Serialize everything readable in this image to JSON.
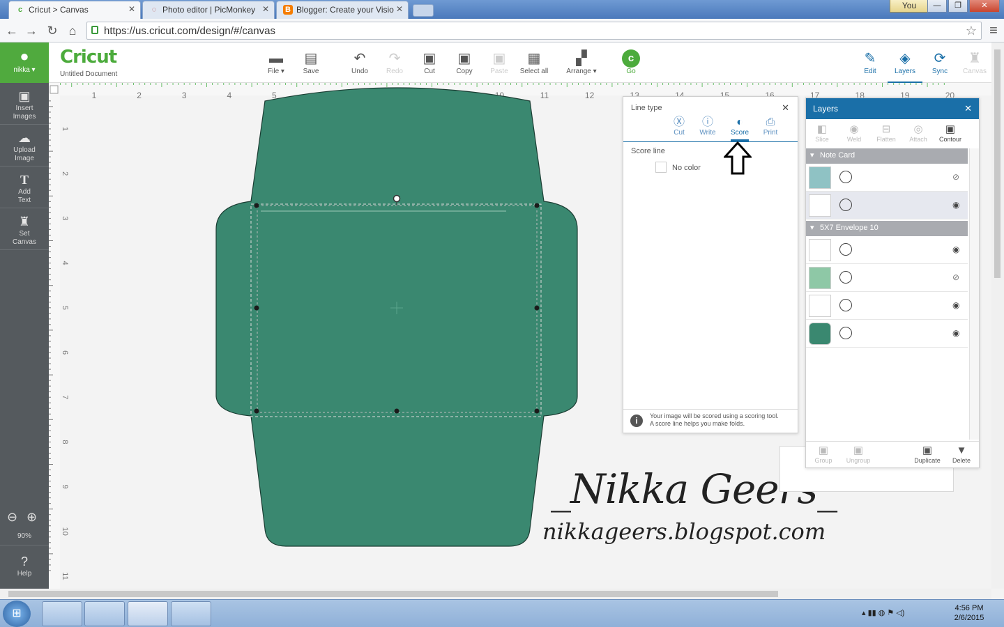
{
  "browser": {
    "tabs": [
      {
        "label": "Cricut > Canvas",
        "active": true
      },
      {
        "label": "Photo editor | PicMonkey",
        "active": false
      },
      {
        "label": "Blogger: Create your Visio",
        "active": false
      }
    ],
    "user_button": "You",
    "url": "https://us.cricut.com/design/#/canvas"
  },
  "header": {
    "logo": "Cricut",
    "document_name": "Untitled Document",
    "user": "nikka",
    "tools": [
      {
        "label": "File",
        "icon": "folder-icon",
        "dropdown": true,
        "enabled": true
      },
      {
        "label": "Save",
        "icon": "save-icon",
        "enabled": true
      },
      {
        "label": "Undo",
        "icon": "undo-icon",
        "enabled": true
      },
      {
        "label": "Redo",
        "icon": "redo-icon",
        "enabled": false
      },
      {
        "label": "Cut",
        "icon": "cut-icon",
        "enabled": true
      },
      {
        "label": "Copy",
        "icon": "copy-icon",
        "enabled": true
      },
      {
        "label": "Paste",
        "icon": "paste-icon",
        "enabled": false
      },
      {
        "label": "Select all",
        "icon": "select-all-icon",
        "enabled": true
      },
      {
        "label": "Arrange",
        "icon": "arrange-icon",
        "dropdown": true,
        "enabled": true
      },
      {
        "label": "Go",
        "icon": "go-icon",
        "enabled": true
      }
    ],
    "right_tools": [
      {
        "label": "Edit",
        "icon": "edit-icon",
        "enabled": true
      },
      {
        "label": "Layers",
        "icon": "layers-icon",
        "enabled": true,
        "active": true
      },
      {
        "label": "Sync",
        "icon": "sync-icon",
        "enabled": true
      },
      {
        "label": "Canvas",
        "icon": "canvas-icon",
        "enabled": false
      }
    ]
  },
  "sidebar": {
    "items": [
      {
        "label1": "Insert",
        "label2": "Images",
        "icon": "image-icon"
      },
      {
        "label1": "Upload",
        "label2": "Image",
        "icon": "upload-icon"
      },
      {
        "label1": "Add",
        "label2": "Text",
        "icon": "text-icon"
      },
      {
        "label1": "Set",
        "label2": "Canvas",
        "icon": "shirt-icon"
      }
    ],
    "zoom": "90%",
    "help": "Help"
  },
  "rulers": {
    "horizontal": [
      "1",
      "2",
      "3",
      "4",
      "5",
      "6",
      "7",
      "8",
      "9",
      "10",
      "11",
      "12",
      "13",
      "14",
      "15",
      "16",
      "17",
      "18",
      "19",
      "20"
    ],
    "vertical": [
      "1",
      "2",
      "3",
      "4",
      "5",
      "6",
      "7",
      "8",
      "9",
      "10",
      "11"
    ]
  },
  "line_type_panel": {
    "title": "Line type",
    "options": [
      {
        "label": "Cut",
        "active": false
      },
      {
        "label": "Write",
        "active": false
      },
      {
        "label": "Score",
        "active": true
      },
      {
        "label": "Print",
        "active": false
      }
    ],
    "section_label": "Score line",
    "color_label": "No color",
    "info_line1": "Your image will be scored using a scoring tool.",
    "info_line2": "A score line helps you make folds."
  },
  "layers_panel": {
    "title": "Layers",
    "top_tools": [
      "Slice",
      "Weld",
      "Flatten",
      "Attach",
      "Contour"
    ],
    "groups": [
      {
        "name": "Note Card",
        "rows": [
          {
            "thumb": "#8fc2c4",
            "op": "cut",
            "visible": false,
            "selected": false
          },
          {
            "thumb": "#ffffff",
            "op": "score",
            "visible": true,
            "selected": true
          }
        ]
      },
      {
        "name": "5X7 Envelope 10",
        "rows": [
          {
            "thumb": "#ffffff",
            "op": "score",
            "visible": true,
            "selected": false
          },
          {
            "thumb": "#8ec8a6",
            "op": "cut",
            "visible": false,
            "selected": false
          },
          {
            "thumb": "#ffffff",
            "op": "score",
            "visible": true,
            "selected": false
          },
          {
            "thumb": "#3a8870",
            "op": "cut",
            "visible": true,
            "selected": false
          }
        ]
      }
    ],
    "bottom_tools": [
      "Group",
      "Ungroup",
      "Duplicate",
      "Delete"
    ]
  },
  "watermark": {
    "name": "_Nikka Geers_",
    "url": "nikkageers.blogspot.com"
  },
  "taskbar": {
    "time": "4:56 PM",
    "date": "2/6/2015"
  },
  "colors": {
    "envelope": "#3a8870",
    "brand_green": "#4cab3c",
    "accent_blue": "#1a6fa8"
  }
}
